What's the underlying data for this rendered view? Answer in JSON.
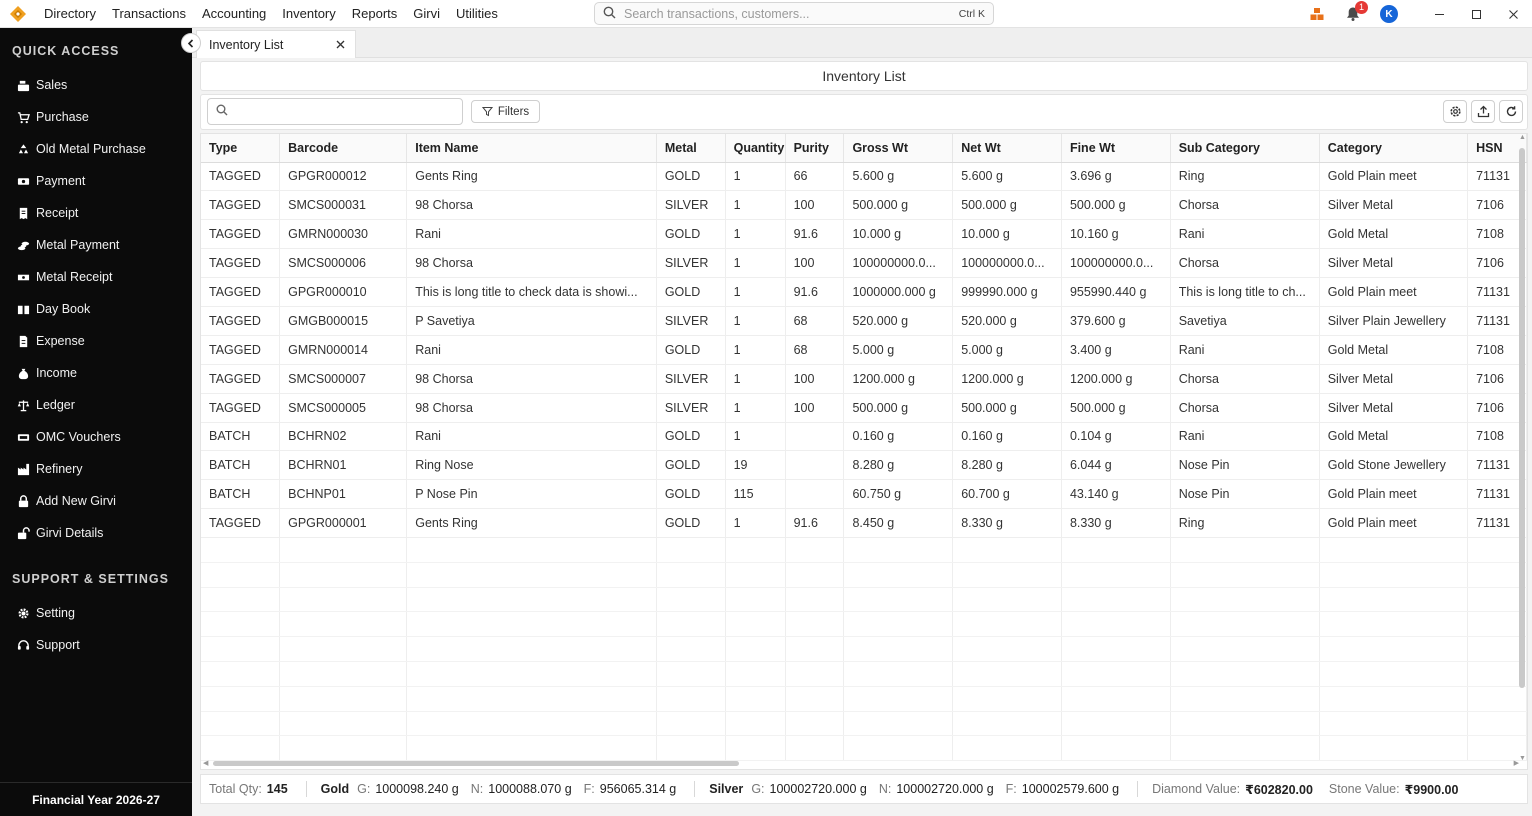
{
  "topbar": {
    "menu": [
      "Directory",
      "Transactions",
      "Accounting",
      "Inventory",
      "Reports",
      "Girvi",
      "Utilities"
    ],
    "search_placeholder": "Search transactions, customers...",
    "search_shortcut": "Ctrl K",
    "notification_count": "1",
    "avatar_initial": "K"
  },
  "sidebar": {
    "quick_access_title": "QUICK ACCESS",
    "quick_access": [
      {
        "label": "Sales",
        "icon": "cash-register-icon"
      },
      {
        "label": "Purchase",
        "icon": "cart-icon"
      },
      {
        "label": "Old Metal Purchase",
        "icon": "recycle-icon"
      },
      {
        "label": "Payment",
        "icon": "money-icon"
      },
      {
        "label": "Receipt",
        "icon": "receipt-icon"
      },
      {
        "label": "Metal Payment",
        "icon": "coins-icon"
      },
      {
        "label": "Metal Receipt",
        "icon": "money-bill-icon"
      },
      {
        "label": "Day Book",
        "icon": "book-icon"
      },
      {
        "label": "Expense",
        "icon": "file-invoice-icon"
      },
      {
        "label": "Income",
        "icon": "money-bag-icon"
      },
      {
        "label": "Ledger",
        "icon": "scale-icon"
      },
      {
        "label": "OMC Vouchers",
        "icon": "ticket-icon"
      },
      {
        "label": "Refinery",
        "icon": "industry-icon"
      },
      {
        "label": "Add New Girvi",
        "icon": "lock-icon"
      },
      {
        "label": "Girvi Details",
        "icon": "unlock-icon"
      }
    ],
    "support_title": "SUPPORT & SETTINGS",
    "support": [
      {
        "label": "Setting",
        "icon": "gear-icon"
      },
      {
        "label": "Support",
        "icon": "headset-icon"
      }
    ],
    "footer": "Financial Year 2026-27"
  },
  "tab": {
    "label": "Inventory List"
  },
  "page_title": "Inventory List",
  "toolbar": {
    "search_value": "",
    "filters_label": "Filters"
  },
  "table": {
    "columns": [
      "Type",
      "Barcode",
      "Item Name",
      "Metal",
      "Quantity",
      "Purity",
      "Gross Wt",
      "Net Wt",
      "Fine Wt",
      "Sub Category",
      "Category",
      "HSN"
    ],
    "rows": [
      [
        "TAGGED",
        "GPGR000012",
        "Gents Ring",
        "GOLD",
        "1",
        "66",
        "5.600 g",
        "5.600 g",
        "3.696 g",
        "Ring",
        "Gold Plain meet",
        "71131"
      ],
      [
        "TAGGED",
        "SMCS000031",
        "98 Chorsa",
        "SILVER",
        "1",
        "100",
        "500.000 g",
        "500.000 g",
        "500.000 g",
        "Chorsa",
        "Silver Metal",
        "7106"
      ],
      [
        "TAGGED",
        "GMRN000030",
        "Rani",
        "GOLD",
        "1",
        "91.6",
        "10.000 g",
        "10.000 g",
        "10.160 g",
        "Rani",
        "Gold Metal",
        "7108"
      ],
      [
        "TAGGED",
        "SMCS000006",
        "98 Chorsa",
        "SILVER",
        "1",
        "100",
        "100000000.0...",
        "100000000.0...",
        "100000000.0...",
        "Chorsa",
        "Silver Metal",
        "7106"
      ],
      [
        "TAGGED",
        "GPGR000010",
        "This is long title to check data is showi...",
        "GOLD",
        "1",
        "91.6",
        "1000000.000 g",
        "999990.000 g",
        "955990.440 g",
        "This is long title to ch...",
        "Gold Plain meet",
        "71131"
      ],
      [
        "TAGGED",
        "GMGB000015",
        "P Savetiya",
        "SILVER",
        "1",
        "68",
        "520.000 g",
        "520.000 g",
        "379.600 g",
        "Savetiya",
        "Silver Plain Jewellery",
        "71131"
      ],
      [
        "TAGGED",
        "GMRN000014",
        "Rani",
        "GOLD",
        "1",
        "68",
        "5.000 g",
        "5.000 g",
        "3.400 g",
        "Rani",
        "Gold Metal",
        "7108"
      ],
      [
        "TAGGED",
        "SMCS000007",
        "98 Chorsa",
        "SILVER",
        "1",
        "100",
        "1200.000 g",
        "1200.000 g",
        "1200.000 g",
        "Chorsa",
        "Silver Metal",
        "7106"
      ],
      [
        "TAGGED",
        "SMCS000005",
        "98 Chorsa",
        "SILVER",
        "1",
        "100",
        "500.000 g",
        "500.000 g",
        "500.000 g",
        "Chorsa",
        "Silver Metal",
        "7106"
      ],
      [
        "BATCH",
        "BCHRN02",
        "Rani",
        "GOLD",
        "1",
        "",
        "0.160 g",
        "0.160 g",
        "0.104 g",
        "Rani",
        "Gold Metal",
        "7108"
      ],
      [
        "BATCH",
        "BCHRN01",
        "Ring Nose",
        "GOLD",
        "19",
        "",
        "8.280 g",
        "8.280 g",
        "6.044 g",
        "Nose Pin",
        "Gold Stone Jewellery",
        "71131"
      ],
      [
        "BATCH",
        "BCHNP01",
        "P Nose Pin",
        "GOLD",
        "115",
        "",
        "60.750 g",
        "60.700 g",
        "43.140 g",
        "Nose Pin",
        "Gold Plain meet",
        "71131"
      ],
      [
        "TAGGED",
        "GPGR000001",
        "Gents Ring",
        "GOLD",
        "1",
        "91.6",
        "8.450 g",
        "8.330 g",
        "8.330 g",
        "Ring",
        "Gold Plain meet",
        "71131"
      ]
    ]
  },
  "summary": {
    "total_qty_label": "Total Qty:",
    "total_qty": "145",
    "gold": {
      "name": "Gold",
      "g_label": "G:",
      "g": "1000098.240 g",
      "n_label": "N:",
      "n": "1000088.070 g",
      "f_label": "F:",
      "f": "956065.314 g"
    },
    "silver": {
      "name": "Silver",
      "g_label": "G:",
      "g": "100002720.000 g",
      "n_label": "N:",
      "n": "100002720.000 g",
      "f_label": "F:",
      "f": "100002579.600 g"
    },
    "diamond_label": "Diamond Value:",
    "diamond": "₹602820.00",
    "stone_label": "Stone Value:",
    "stone": "₹9900.00"
  }
}
